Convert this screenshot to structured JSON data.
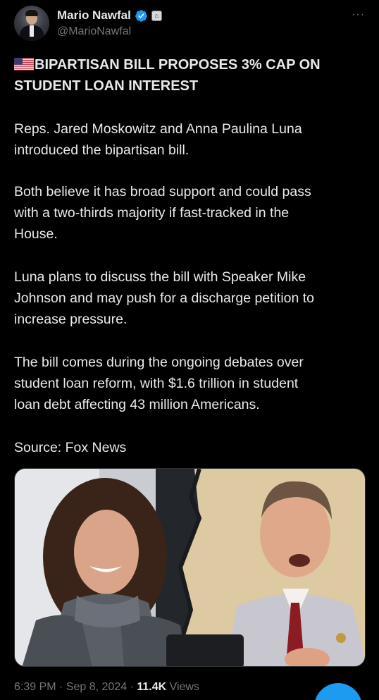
{
  "author": {
    "name": "Mario Nawfal",
    "handle": "@MarioNawfal",
    "verified": true
  },
  "menu": {
    "more_label": "···"
  },
  "tweet": {
    "headline_line1": "BIPARTISAN BILL PROPOSES 3% CAP ON",
    "headline_line2": "STUDENT LOAN INTEREST",
    "paragraphs": [
      [
        "Reps. Jared Moskowitz and Anna Paulina Luna",
        "introduced the bipartisan bill."
      ],
      [
        "Both believe it has broad support and could pass",
        "with a two-thirds majority if fast-tracked in the",
        "House."
      ],
      [
        "Luna plans to discuss the bill with Speaker Mike",
        "Johnson and may push for a discharge petition to",
        "increase pressure."
      ],
      [
        "The bill comes during the ongoing debates over",
        "student loan reform, with $1.6 trillion in student",
        "loan debt affecting 43 million Americans."
      ],
      [
        "Source: Fox News"
      ]
    ]
  },
  "meta": {
    "time": "6:39 PM",
    "sep1": " · ",
    "date": "Sep 8, 2024",
    "sep2": " · ",
    "views_count": "11.4K",
    "views_label": " Views"
  },
  "colors": {
    "background": "#000000",
    "text_primary": "#e7e9ea",
    "text_secondary": "#71767b",
    "accent": "#1d9bf0"
  }
}
